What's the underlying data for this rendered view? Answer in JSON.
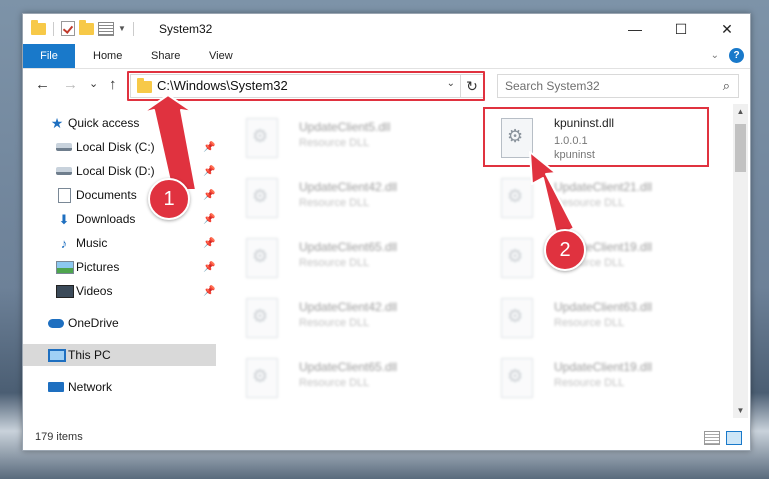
{
  "window": {
    "title": "System32",
    "controls": {
      "minimize": "—",
      "maximize": "☐",
      "close": "✕"
    }
  },
  "ribbon": {
    "tabs": [
      {
        "label": "File",
        "active": true
      },
      {
        "label": "Home"
      },
      {
        "label": "Share"
      },
      {
        "label": "View"
      }
    ],
    "help": "?"
  },
  "navigation": {
    "back": "←",
    "forward": "→",
    "recent": "⌄",
    "up": "↑",
    "address": "C:\\Windows\\System32",
    "refresh": "↻",
    "search_placeholder": "Search System32"
  },
  "sidebar": {
    "items": [
      {
        "label": "Quick access",
        "icon": "star-icon"
      },
      {
        "label": "Local Disk (C:)",
        "icon": "disk-icon",
        "pinned": true
      },
      {
        "label": "Local Disk (D:)",
        "icon": "disk-icon",
        "pinned": true
      },
      {
        "label": "Documents",
        "icon": "document-icon",
        "pinned": true
      },
      {
        "label": "Downloads",
        "icon": "download-icon",
        "pinned": true
      },
      {
        "label": "Music",
        "icon": "music-icon",
        "pinned": true
      },
      {
        "label": "Pictures",
        "icon": "picture-icon",
        "pinned": true
      },
      {
        "label": "Videos",
        "icon": "video-icon",
        "pinned": true
      },
      {
        "label": "OneDrive",
        "icon": "cloud-icon"
      },
      {
        "label": "This PC",
        "icon": "computer-icon",
        "selected": true
      },
      {
        "label": "Network",
        "icon": "network-icon"
      }
    ]
  },
  "files": [
    {
      "name": "UpdateClient5.dll",
      "type": "Resource DLL",
      "blurred": true
    },
    {
      "name": "kpuninst.dll",
      "version": "1.0.0.1",
      "description": "kpuninst",
      "highlighted": true
    },
    {
      "name": "UpdateClient42.dll",
      "type": "Resource DLL",
      "blurred": true
    },
    {
      "name": "UpdateClient21.dll",
      "type": "Resource DLL",
      "blurred": true
    },
    {
      "name": "UpdateClient65.dll",
      "type": "Resource DLL",
      "blurred": true
    },
    {
      "name": "UpdateClient19.dll",
      "type": "Resource DLL",
      "blurred": true
    },
    {
      "name": "UpdateClient42.dll",
      "type": "Resource DLL",
      "blurred": true
    },
    {
      "name": "UpdateClient63.dll",
      "type": "Resource DLL",
      "blurred": true
    },
    {
      "name": "UpdateClient65.dll",
      "type": "Resource DLL",
      "blurred": true
    },
    {
      "name": "UpdateClient19.dll",
      "type": "Resource DLL",
      "blurred": true
    }
  ],
  "status": {
    "item_count": "179 items"
  },
  "callouts": [
    {
      "label": "1"
    },
    {
      "label": "2"
    }
  ],
  "colors": {
    "accent": "#1979ca",
    "highlight": "#e0323f"
  }
}
